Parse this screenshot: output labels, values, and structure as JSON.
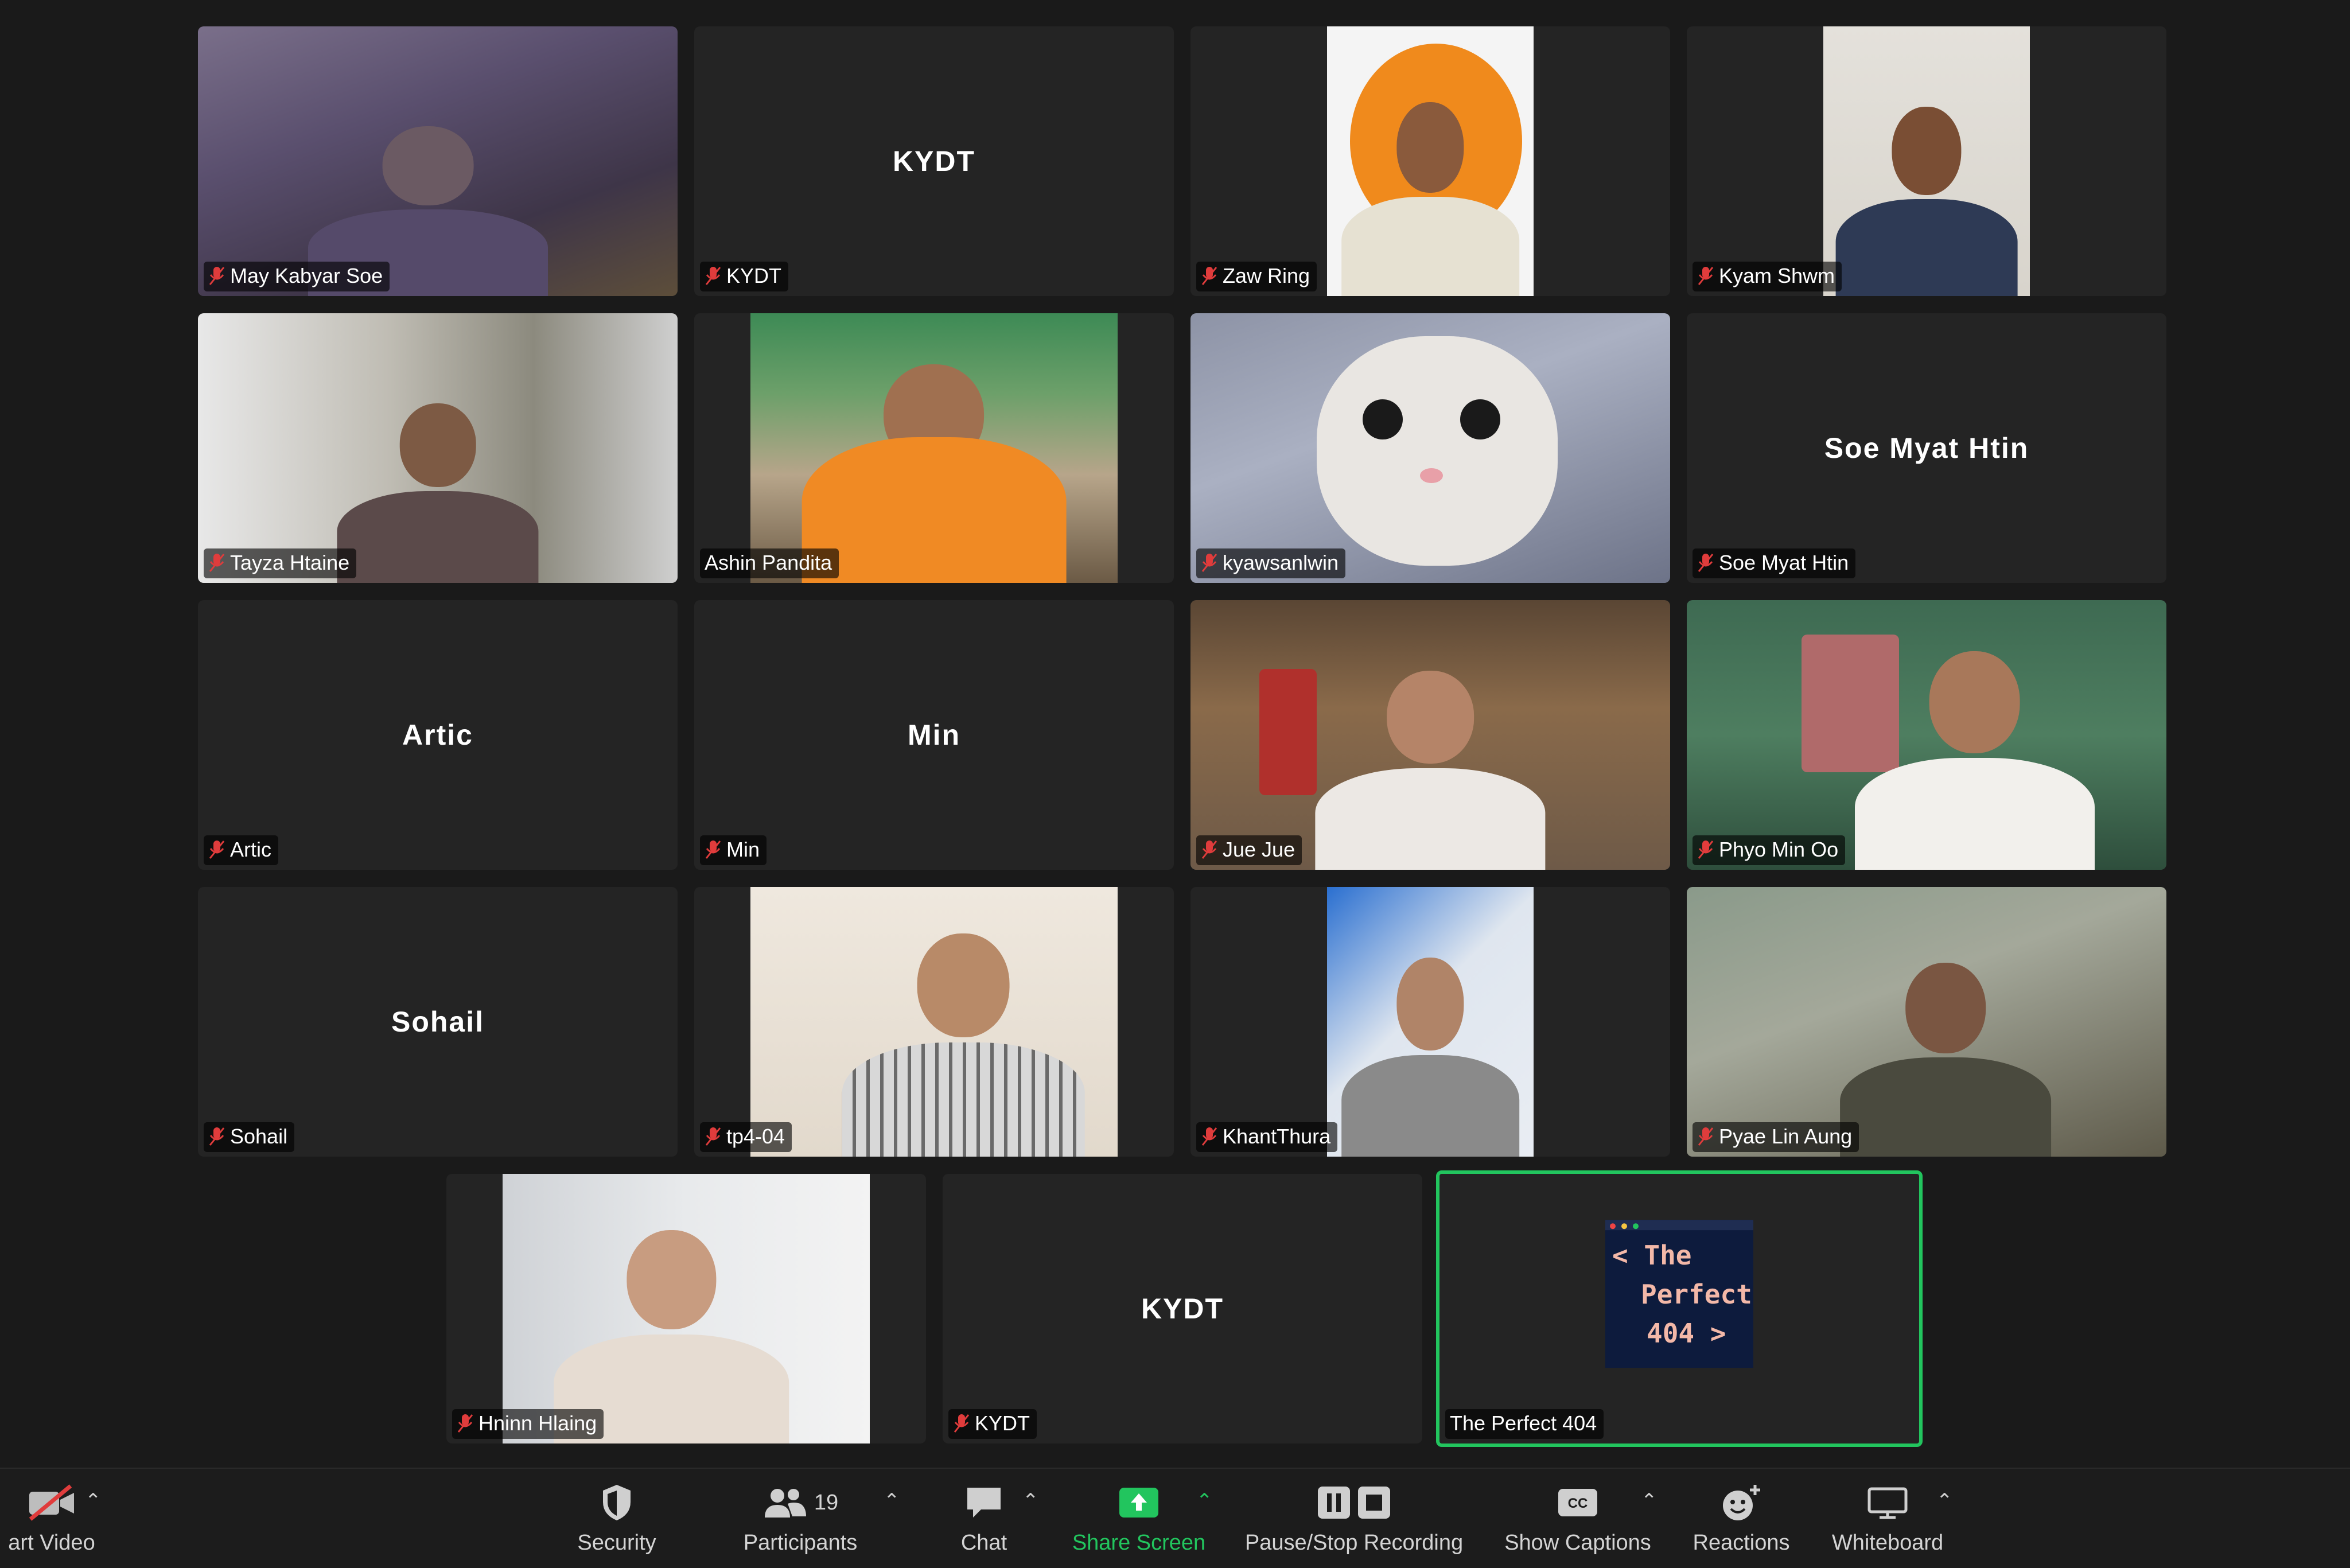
{
  "participants": [
    {
      "name": "May Kabyar Soe",
      "muted": true
    },
    {
      "name": "KYDT",
      "muted": true,
      "center_label": "KYDT"
    },
    {
      "name": "Zaw Ring",
      "muted": true
    },
    {
      "name": "Kyam Shwm",
      "muted": true
    },
    {
      "name": "Tayza Htaine",
      "muted": true
    },
    {
      "name": "Ashin Pandita",
      "muted": false
    },
    {
      "name": "kyawsanlwin",
      "muted": true
    },
    {
      "name": "Soe Myat Htin",
      "muted": true,
      "center_label": "Soe Myat Htin"
    },
    {
      "name": "Artic",
      "muted": true,
      "center_label": "Artic"
    },
    {
      "name": "Min",
      "muted": true,
      "center_label": "Min"
    },
    {
      "name": "Jue Jue",
      "muted": true
    },
    {
      "name": "Phyo Min Oo",
      "muted": true
    },
    {
      "name": "Sohail",
      "muted": true,
      "center_label": "Sohail"
    },
    {
      "name": "tp4-04",
      "muted": true
    },
    {
      "name": "KhantThura",
      "muted": true
    },
    {
      "name": "Pyae Lin Aung",
      "muted": true
    },
    {
      "name": "Hninn Hlaing",
      "muted": true
    },
    {
      "name": "KYDT",
      "muted": true,
      "center_label": "KYDT"
    },
    {
      "name": "The Perfect 404",
      "muted": false,
      "active_speaker": true,
      "logo_lines": [
        "< The",
        "Perfect",
        "404 >"
      ]
    }
  ],
  "toolbar": {
    "start_video": "art Video",
    "security": "Security",
    "participants": "Participants",
    "participants_count": "19",
    "chat": "Chat",
    "share_screen": "Share Screen",
    "pause_recording": "Pause/Stop Recording",
    "show_captions": "Show Captions",
    "reactions": "Reactions",
    "whiteboard": "Whiteboard"
  },
  "colors": {
    "active_border": "#22c55e",
    "share_green": "#22c55e",
    "muted_red": "#e03c3c",
    "background": "#1a1a1a",
    "tile": "#242424"
  }
}
